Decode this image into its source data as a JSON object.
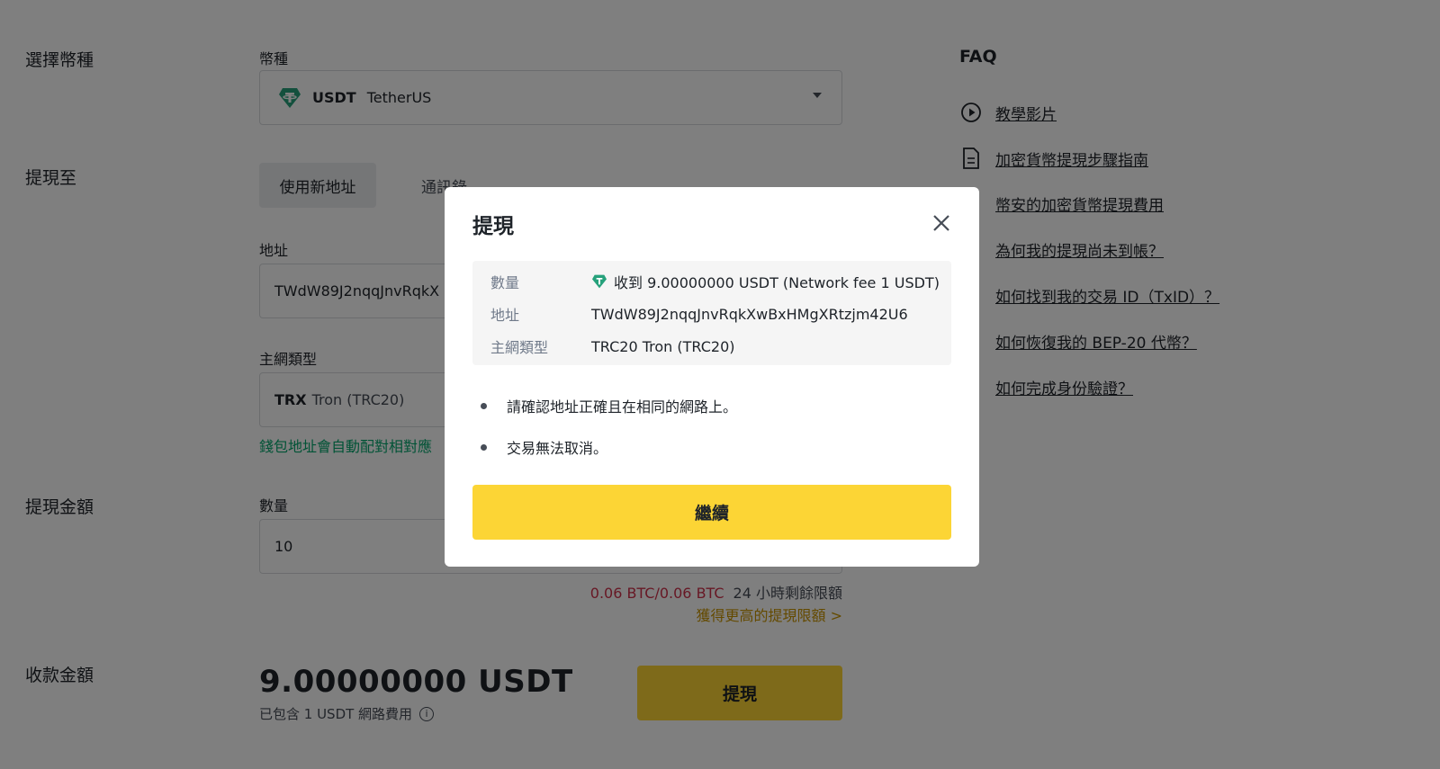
{
  "form": {
    "select_coin_label": "選擇幣種",
    "coin_field_label": "幣種",
    "coin_code": "USDT",
    "coin_name": "TetherUS",
    "withdraw_to_label": "提現至",
    "tab_new_address": "使用新地址",
    "tab_address_book": "通訊錄",
    "address_label": "地址",
    "address_value": "TWdW89J2nqqJnvRqkX",
    "network_label": "主網類型",
    "network_code": "TRX",
    "network_name": "Tron (TRC20)",
    "network_note": "錢包地址會自動配對相對應",
    "amount_section_label": "提現金額",
    "amount_field_label": "數量",
    "amount_value": "10",
    "limit_used": "0.06 BTC/0.06 BTC",
    "limit_text": "24 小時剩餘限額",
    "limit_link": "獲得更高的提現限額 >",
    "receive_label": "收款金額",
    "receive_amount": "9.00000000 USDT",
    "fee_note": "已包含 1 USDT 網路費用",
    "withdraw_button": "提現"
  },
  "faq": {
    "title": "FAQ",
    "items": [
      {
        "label": "教學影片",
        "icon": "play-circle-icon"
      },
      {
        "label": "加密貨幣提現步驟指南",
        "icon": "document-icon"
      },
      {
        "label": "幣安的加密貨幣提現費用",
        "icon": "document-icon"
      },
      {
        "label": "為何我的提現尚未到帳？",
        "icon": "document-icon"
      },
      {
        "label": "如何找到我的交易 ID（TxID）？",
        "icon": "document-icon"
      },
      {
        "label": "如何恢復我的 BEP-20 代幣？",
        "icon": "document-icon"
      },
      {
        "label": "如何完成身份驗證？",
        "icon": "document-icon"
      }
    ]
  },
  "modal": {
    "title": "提現",
    "rows": [
      {
        "key": "數量",
        "value": "收到 9.00000000 USDT (Network fee 1 USDT)"
      },
      {
        "key": "地址",
        "value": "TWdW89J2nqqJnvRqkXwBxHMgXRtzjm42U6"
      },
      {
        "key": "主網類型",
        "value": "TRC20 Tron (TRC20)"
      }
    ],
    "bullets": [
      "請確認地址正確且在相同的網路上。",
      "交易無法取消。"
    ],
    "continue_button": "繼續"
  },
  "colors": {
    "accent": "#fcd535",
    "usdt_green": "#26a17b",
    "green_note": "#03a66d",
    "limit_red": "#cf304a",
    "link_gold": "#c99400"
  }
}
